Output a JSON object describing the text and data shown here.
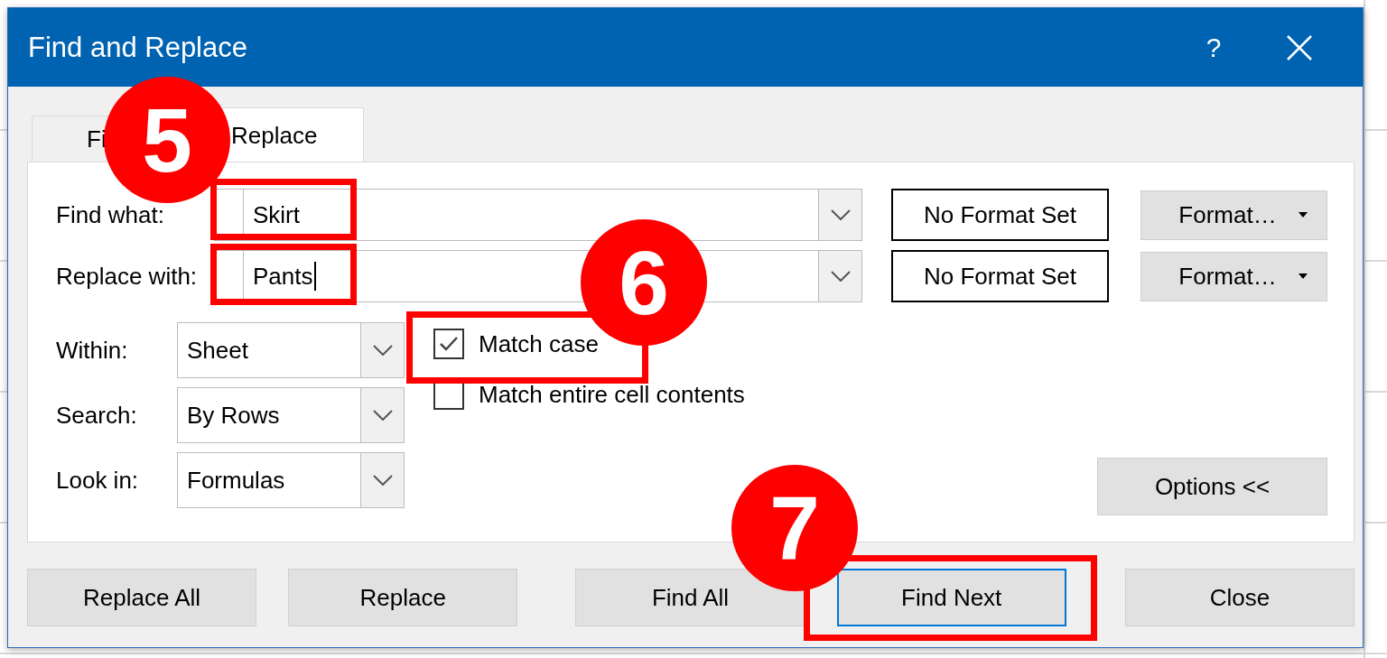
{
  "window": {
    "title": "Find and Replace",
    "help": "?"
  },
  "tabs": [
    {
      "label": "Fi",
      "selected": false
    },
    {
      "label": "Replace",
      "selected": true
    }
  ],
  "fields": [
    {
      "label": "Find what:",
      "value": "Skirt",
      "focused": false,
      "format": "No Format Set",
      "format_button": "Format…"
    },
    {
      "label": "Replace with:",
      "value": "Pants",
      "focused": true,
      "format": "No Format Set",
      "format_button": "Format…"
    }
  ],
  "dropdowns": [
    {
      "label": "Within:",
      "value": "Sheet"
    },
    {
      "label": "Search:",
      "value": "By Rows"
    },
    {
      "label": "Look in:",
      "value": "Formulas"
    }
  ],
  "checkboxes": [
    {
      "label": "Match case",
      "checked": true
    },
    {
      "label": "Match entire cell contents",
      "checked": false
    }
  ],
  "options_button": "Options <<",
  "buttons": [
    {
      "label": "Replace All",
      "default": false
    },
    {
      "label": "Replace",
      "default": false
    },
    {
      "label": "Find All",
      "default": false
    },
    {
      "label": "Find Next",
      "default": true
    },
    {
      "label": "Close",
      "default": false
    }
  ],
  "annotations": [
    {
      "number": "5"
    },
    {
      "number": "6"
    },
    {
      "number": "7"
    }
  ]
}
